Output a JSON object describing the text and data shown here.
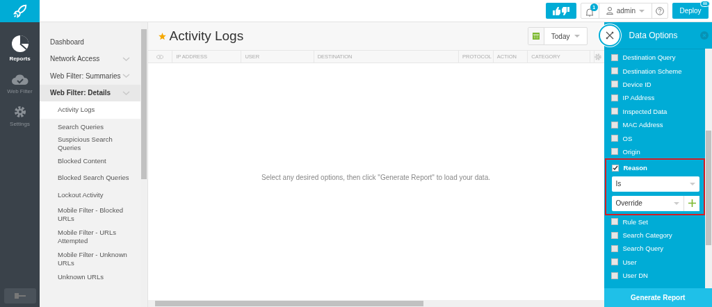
{
  "topbar": {
    "notifications": "1",
    "user": "admin",
    "deploy": "Deploy"
  },
  "rail": [
    {
      "label": "Reports",
      "selected": true
    },
    {
      "label": "Web Filter",
      "selected": false
    },
    {
      "label": "Settings",
      "selected": false
    }
  ],
  "nav": [
    {
      "label": "Dashboard",
      "expanded": false,
      "selected": false
    },
    {
      "label": "Network Access",
      "expanded": false,
      "selected": false,
      "collapsible": true
    },
    {
      "label": "Web Filter: Summaries",
      "expanded": false,
      "selected": false,
      "collapsible": true
    },
    {
      "label": "Web Filter: Details",
      "expanded": true,
      "selected": false,
      "collapsible": true,
      "children": [
        {
          "label": "Activity Logs",
          "selected": true
        },
        {
          "label": "Search Queries",
          "selected": false
        },
        {
          "label": "Suspicious Search Queries",
          "selected": false
        },
        {
          "label": "Blocked Content",
          "selected": false
        },
        {
          "label": "Blocked Search Queries",
          "selected": false
        },
        {
          "label": "Lockout Activity",
          "selected": false
        },
        {
          "label": "Mobile Filter - Blocked URLs",
          "selected": false
        },
        {
          "label": "Mobile Filter - URLs Attempted",
          "selected": false
        },
        {
          "label": "Mobile Filter - Unknown URLs",
          "selected": false
        },
        {
          "label": "Unknown URLs",
          "selected": false
        }
      ]
    }
  ],
  "page": {
    "title": "Activity Logs",
    "favorite": true,
    "date_range": "Today"
  },
  "table": {
    "columns": [
      "IP ADDRESS",
      "USER",
      "DESTINATION",
      "PROTOCOL",
      "ACTION",
      "CATEGORY"
    ],
    "empty_message": "Select any desired options, then click \"Generate Report\" to load your data."
  },
  "data_options": {
    "title": "Data Options",
    "options": [
      {
        "label": "Destination Query",
        "checked": false
      },
      {
        "label": "Destination Scheme",
        "checked": false
      },
      {
        "label": "Device ID",
        "checked": false
      },
      {
        "label": "IP Address",
        "checked": false
      },
      {
        "label": "Inspected Data",
        "checked": false
      },
      {
        "label": "MAC Address",
        "checked": false
      },
      {
        "label": "OS",
        "checked": false
      },
      {
        "label": "Origin",
        "checked": false
      },
      {
        "label": "Reason",
        "checked": true,
        "highlighted": true,
        "filter": {
          "operator": "Is",
          "value": "Override"
        }
      },
      {
        "label": "Rule Set",
        "checked": false
      },
      {
        "label": "Search Category",
        "checked": false
      },
      {
        "label": "Search Query",
        "checked": false
      },
      {
        "label": "User",
        "checked": false
      },
      {
        "label": "User DN",
        "checked": false
      }
    ],
    "button": "Generate Report"
  }
}
